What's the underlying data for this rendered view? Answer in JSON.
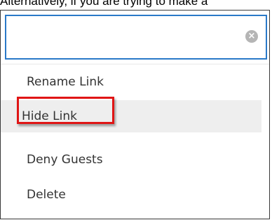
{
  "page": {
    "top_text": "Alternatively, if you are trying to make a"
  },
  "search": {
    "value": "",
    "clear_icon": "clear-circle-x-icon"
  },
  "menu": {
    "items": [
      {
        "label": "Rename Link"
      },
      {
        "label": "Hide Link"
      },
      {
        "label": "Deny Guests"
      },
      {
        "label": "Delete"
      }
    ],
    "highlighted_index": 1
  },
  "colors": {
    "focus_border": "#2a79c8",
    "highlight_outline": "#e01515",
    "hover_background": "#eeeeee",
    "text": "#333333"
  }
}
